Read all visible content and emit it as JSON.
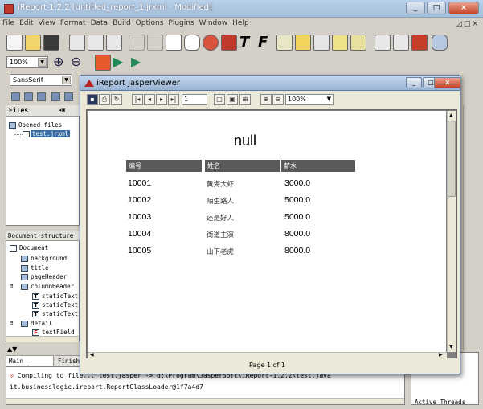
{
  "main_window": {
    "title": "iReport 1.2.2 [untitled_report_1.jrxml - Modified]",
    "controls": [
      "_",
      "□",
      "×"
    ]
  },
  "menubar": {
    "items": [
      "File",
      "Edit",
      "View",
      "Format",
      "Data",
      "Build",
      "Options",
      "Plugins",
      "Window",
      "Help"
    ],
    "mdi_controls": "◿□×"
  },
  "toolbar": {
    "zoom": "100%",
    "font": "SansSerif"
  },
  "files_panel": {
    "tab_label": "Files",
    "root": "Opened files",
    "file": "test.jrxml"
  },
  "document_structure": {
    "tab_label": "Document structure",
    "items": [
      "Document",
      "background",
      "title",
      "pageHeader",
      "columnHeader",
      "staticText",
      "staticText",
      "staticText",
      "detail",
      "textField"
    ]
  },
  "bottom_tabs": [
    "Main console",
    "Finish"
  ],
  "console": {
    "line1": "Compiling to file... test.jasper -> d:\\Program\\JasperSoft\\iReport-1.2.2\\test.java",
    "line2": "it.businesslogic.ireport.ReportClassLoader@1f7a4d7"
  },
  "threads_label": "Active Threads",
  "viewer": {
    "title": "iReport JasperViewer",
    "page_input": "1",
    "zoom": "100%",
    "status": "Page 1 of 1",
    "controls": [
      "_",
      "□",
      "×"
    ]
  },
  "report": {
    "title": "null",
    "columns": [
      "编号",
      "姓名",
      "薪水"
    ],
    "rows": [
      [
        "10001",
        "黄海大虾",
        "3000.0"
      ],
      [
        "10002",
        "陌生路人",
        "5000.0"
      ],
      [
        "10003",
        "还是好人",
        "5000.0"
      ],
      [
        "10004",
        "街道主演",
        "8000.0"
      ],
      [
        "10005",
        "山下老虎",
        "8000.0"
      ]
    ]
  }
}
